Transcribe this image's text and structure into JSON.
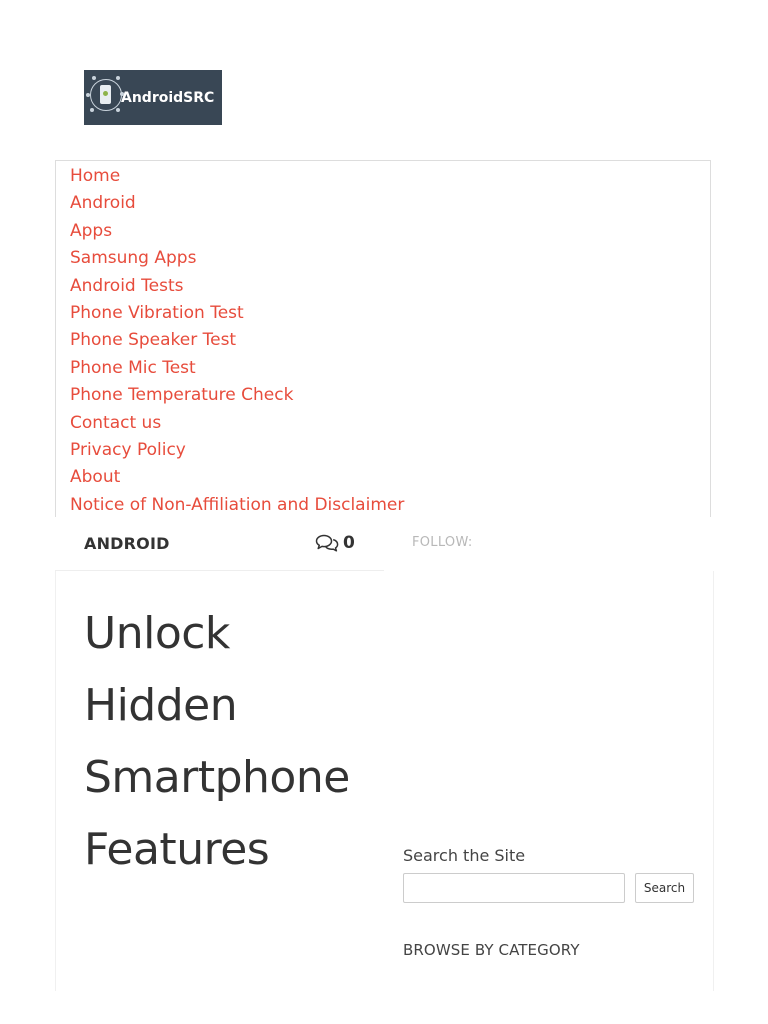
{
  "logo": {
    "text": "AndroidSRC",
    "icon": "globe-phone-network-icon",
    "background": "#394755"
  },
  "nav": {
    "link_color": "#e74c3c",
    "items": [
      {
        "label": "Home"
      },
      {
        "label": "Android"
      },
      {
        "label": "Apps"
      },
      {
        "label": "Samsung Apps"
      },
      {
        "label": "Android Tests"
      },
      {
        "label": "Phone Vibration Test"
      },
      {
        "label": "Phone Speaker Test"
      },
      {
        "label": "Phone Mic Test"
      },
      {
        "label": "Phone Temperature Check"
      },
      {
        "label": "Contact us"
      },
      {
        "label": "Privacy Policy"
      },
      {
        "label": "About"
      },
      {
        "label": "Notice of Non-Affiliation and Disclaimer"
      }
    ]
  },
  "post_meta": {
    "category": "ANDROID",
    "comment_icon": "comments-icon",
    "comment_count": "0",
    "follow_label": "FOLLOW:"
  },
  "article": {
    "title": "Unlock Hidden Smartphone Features"
  },
  "sidebar": {
    "search_title": "Search the Site",
    "search_value": "",
    "search_placeholder": "",
    "search_button": "Search",
    "browse_title": "BROWSE BY CATEGORY"
  }
}
